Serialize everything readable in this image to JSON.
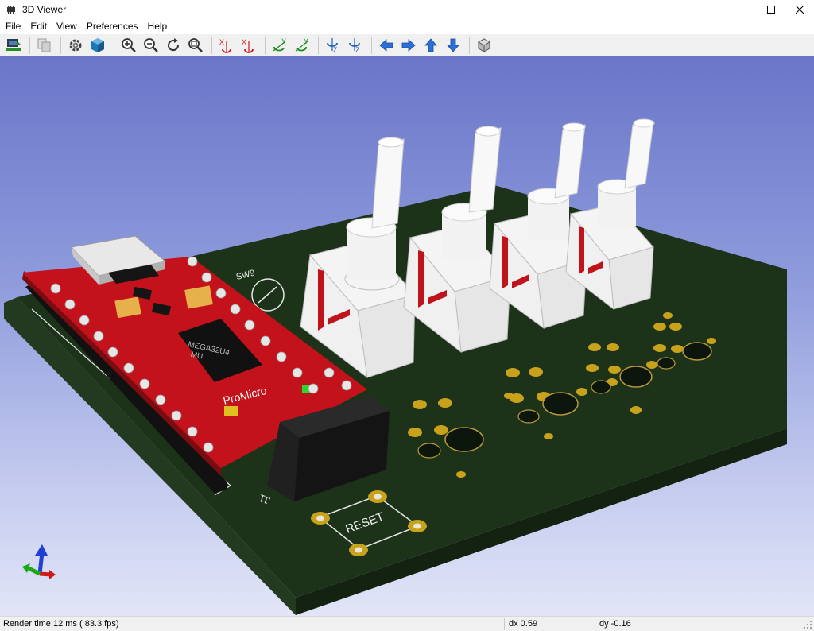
{
  "window": {
    "title": "3D Viewer",
    "icon": "pcb-chip-icon"
  },
  "menu": {
    "file": "File",
    "edit": "Edit",
    "view": "View",
    "preferences": "Preferences",
    "help": "Help"
  },
  "toolbar": {
    "tools": [
      "reload-board-icon",
      "copy-image-icon",
      "settings-gear-icon",
      "raytracing-cube-icon",
      "zoom-in-icon",
      "zoom-out-icon",
      "redraw-icon",
      "zoom-fit-icon",
      "rotate-x-cw-icon",
      "rotate-x-ccw-icon",
      "rotate-y-cw-icon",
      "rotate-y-ccw-icon",
      "rotate-z-cw-icon",
      "rotate-z-ccw-icon",
      "pan-left-icon",
      "pan-right-icon",
      "pan-up-icon",
      "pan-down-icon",
      "orthographic-cube-icon"
    ]
  },
  "scene": {
    "silkscreen": {
      "sw_label": "SW9",
      "chip_line1": "MEGA32U4",
      "chip_line2": "-MU",
      "board_name": "ProMicro",
      "header_label": "J1",
      "reset_label": "RESET"
    }
  },
  "status": {
    "render_time": "Render time 12 ms ( 83.3 fps)",
    "dx": "dx 0.59",
    "dy": "dy -0.16"
  },
  "colors": {
    "pcb": "#1c3319",
    "promicro": "#c3121b",
    "pad_gold": "#c8a21a",
    "switch_body": "#f4f4f4",
    "switch_accent": "#c0141c",
    "header_black": "#1a1a1a"
  }
}
